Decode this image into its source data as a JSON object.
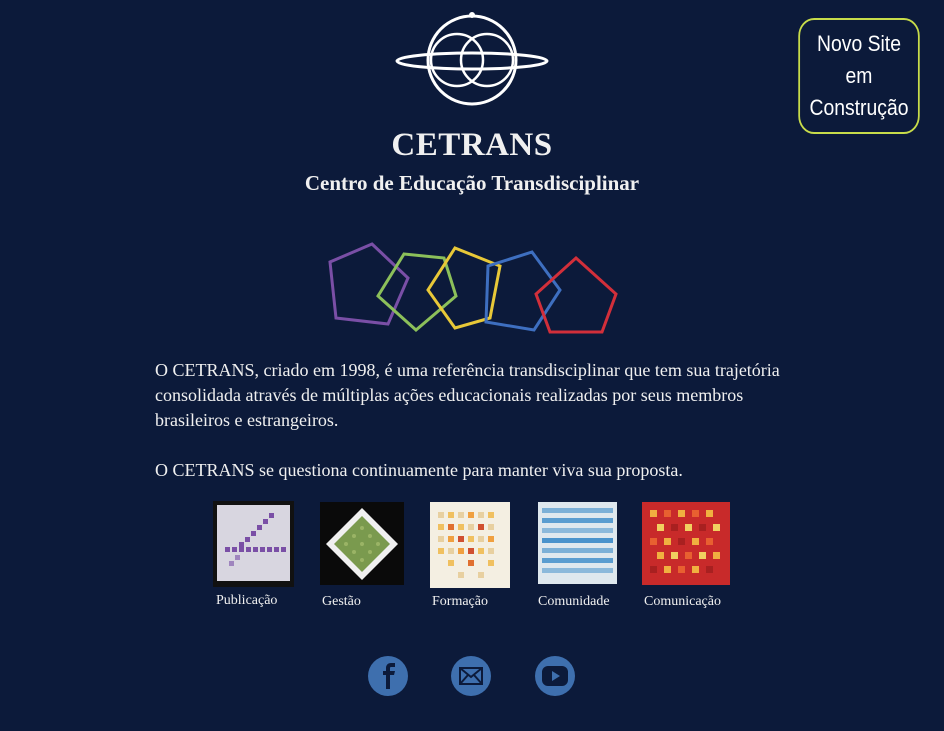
{
  "header": {
    "title": "CETRANS",
    "subtitle": "Centro de Educação Transdisciplinar"
  },
  "badge": {
    "line1": "Novo Site",
    "line2": "em",
    "line3": "Construção"
  },
  "intro": {
    "paragraph1": "O CETRANS, criado em 1998, é uma referência transdisciplinar que tem sua trajetória consolidada através de múltiplas ações educacionais realizadas por seus membros brasileiros e estrangeiros.",
    "paragraph2": "O CETRANS se questiona continuamente para manter viva sua proposta."
  },
  "sections": [
    {
      "label": "Publicação"
    },
    {
      "label": "Gestão"
    },
    {
      "label": "Formação"
    },
    {
      "label": "Comunidade"
    },
    {
      "label": "Comunicação"
    }
  ],
  "pentagon_colors": [
    "#7a4fa6",
    "#8cc05a",
    "#e8c838",
    "#3e6fc0",
    "#d22f3a"
  ],
  "social": [
    {
      "icon": "facebook-icon"
    },
    {
      "icon": "email-icon"
    },
    {
      "icon": "youtube-icon"
    }
  ],
  "colors": {
    "background": "#0c1a3a",
    "badge_border": "#c8dc4a",
    "social_icon": "#3e6fae"
  }
}
